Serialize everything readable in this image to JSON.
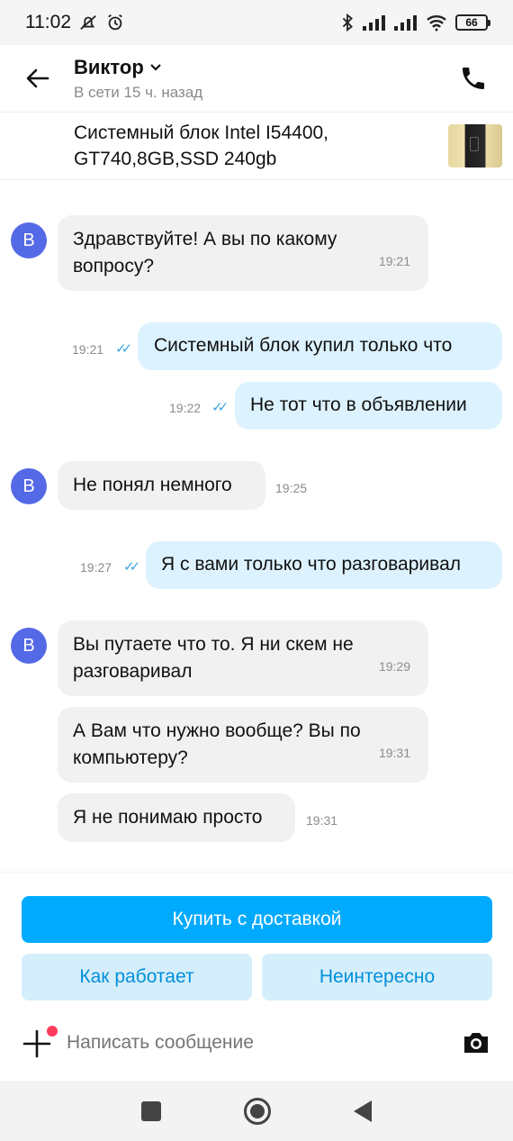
{
  "status_bar": {
    "time": "11:02",
    "battery": "66"
  },
  "header": {
    "name": "Виктор",
    "status": "В сети 15 ч. назад"
  },
  "listing": {
    "title": "Системный блок Intel I54400, GT740,8GB,SSD 240gb"
  },
  "avatar_letter": "В",
  "messages": [
    {
      "dir": "in",
      "line1": "Здравствуйте! А вы по какому",
      "line2": "вопросу?",
      "time": "19:21"
    },
    {
      "dir": "out",
      "text": "Системный блок купил только что",
      "time": "19:21"
    },
    {
      "dir": "out",
      "text": "Не тот что в объявлении",
      "time": "19:22"
    },
    {
      "dir": "in",
      "text": "Не понял немного",
      "time": "19:25"
    },
    {
      "dir": "out",
      "text": "Я с вами только что разговаривал",
      "time": "19:27"
    },
    {
      "dir": "in",
      "line1": "Вы путаете что то. Я ни скем не",
      "line2": "разговаривал",
      "time": "19:29"
    },
    {
      "dir": "in",
      "line1": "А Вам что нужно вообще? Вы по",
      "line2": "компьютеру?",
      "time": "19:31"
    },
    {
      "dir": "in",
      "text": "Я не понимаю просто",
      "time": "19:31"
    }
  ],
  "actions": {
    "buy": "Купить с доставкой",
    "how": "Как работает",
    "not_interested": "Неинтересно"
  },
  "composer": {
    "placeholder": "Написать сообщение"
  }
}
